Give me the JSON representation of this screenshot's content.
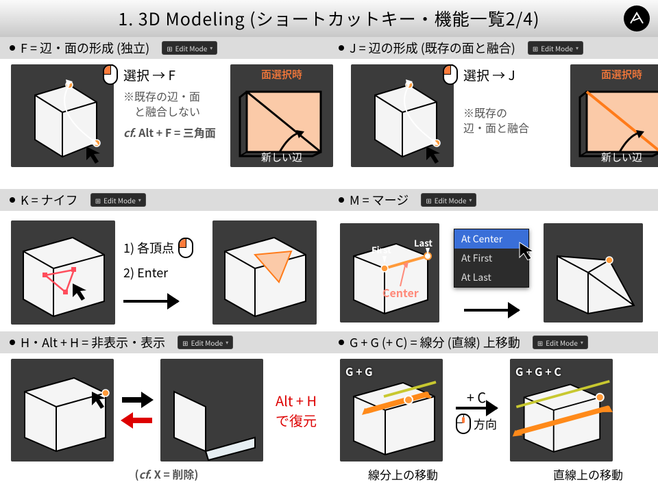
{
  "title": "1. 3D Modeling (ショートカットキー・機能一覧2/4)",
  "mode_badge": "Edit Mode",
  "sections": {
    "f": {
      "heading": "F = 辺・面の形成 (独立)",
      "step": "選択 → F",
      "note1": "※既存の辺・面\n　と融合しない",
      "note2_prefix": "cf.",
      "note2": " Alt + F = 三角面",
      "face_sel": "面選択時",
      "new_edge": "新しい辺"
    },
    "j": {
      "heading": "J = 辺の形成 (既存の面と融合)",
      "step": "選択 → J",
      "note": "※既存の\n辺・面と融合",
      "face_sel": "面選択時",
      "new_edge": "新しい辺"
    },
    "k": {
      "heading": "K = ナイフ",
      "step1": "1) 各頂点",
      "step2": "2) Enter"
    },
    "m": {
      "heading": "M = マージ",
      "labels": {
        "first": "First",
        "last": "Last",
        "center": "Center"
      },
      "menu": [
        "At Center",
        "At First",
        "At Last"
      ]
    },
    "h": {
      "heading": "H・Alt + H = 非表示・表示",
      "restore1": "Alt + H",
      "restore2": "で復元",
      "footer": "(cf. X = 削除)"
    },
    "gg": {
      "heading": "G + G (+ C) = 線分 (直線) 上移動",
      "lab1": "G + G",
      "lab2": "G + G + C",
      "plus_c": "+ C",
      "dir": "方向",
      "cap1": "線分上の移動",
      "cap2": "直線上の移動"
    }
  }
}
